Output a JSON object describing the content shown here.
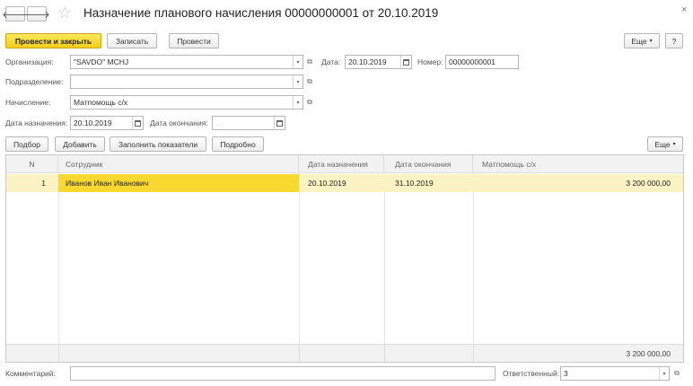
{
  "window": {
    "title": "Назначение планового начисления 00000000001 от 20.10.2019",
    "back_glyph": "🡐",
    "forward_glyph": "🡒",
    "star_glyph": "☆",
    "close_glyph": "×"
  },
  "toolbar": {
    "post_close_label": "Провести и закрыть",
    "save_label": "Записать",
    "post_label": "Провести",
    "more_label": "Еще",
    "help_label": "?"
  },
  "form": {
    "org_label": "Организация:",
    "org_value": "\"SAVDO\" MCHJ",
    "date_label": "Дата:",
    "date_value": "20.10.2019",
    "number_label": "Номер:",
    "number_value": "00000000001",
    "division_label": "Подразделение:",
    "division_value": "",
    "accrual_label": "Начисление:",
    "accrual_value": "Матпомощь с/х",
    "assign_date_label": "Дата назначения:",
    "assign_date_value": "20.10.2019",
    "end_date_label": "Дата окончания:",
    "end_date_value": ". ."
  },
  "table_toolbar": {
    "select_label": "Подбор",
    "add_label": "Добавить",
    "fill_label": "Заполнить показатели",
    "detail_label": "Подробно",
    "more_label": "Еще"
  },
  "table": {
    "columns": [
      "N",
      "Сотрудник",
      "Дата назначения",
      "Дата окончания",
      "Матпомощь с/х"
    ],
    "rows": [
      {
        "n": "1",
        "employee": "Иванов Иван Иванович",
        "start": "20.10.2019",
        "end": "31.10.2019",
        "amount": "3 200 000,00"
      }
    ],
    "total_amount": "3 200 000,00"
  },
  "footer": {
    "comment_label": "Комментарий:",
    "comment_value": "",
    "responsible_label": "Ответственный:",
    "responsible_value": "3"
  },
  "colors": {
    "accent_yellow": "#f5d327",
    "selected_row": "#fbf3c4",
    "selected_cell": "#f9d92f"
  }
}
